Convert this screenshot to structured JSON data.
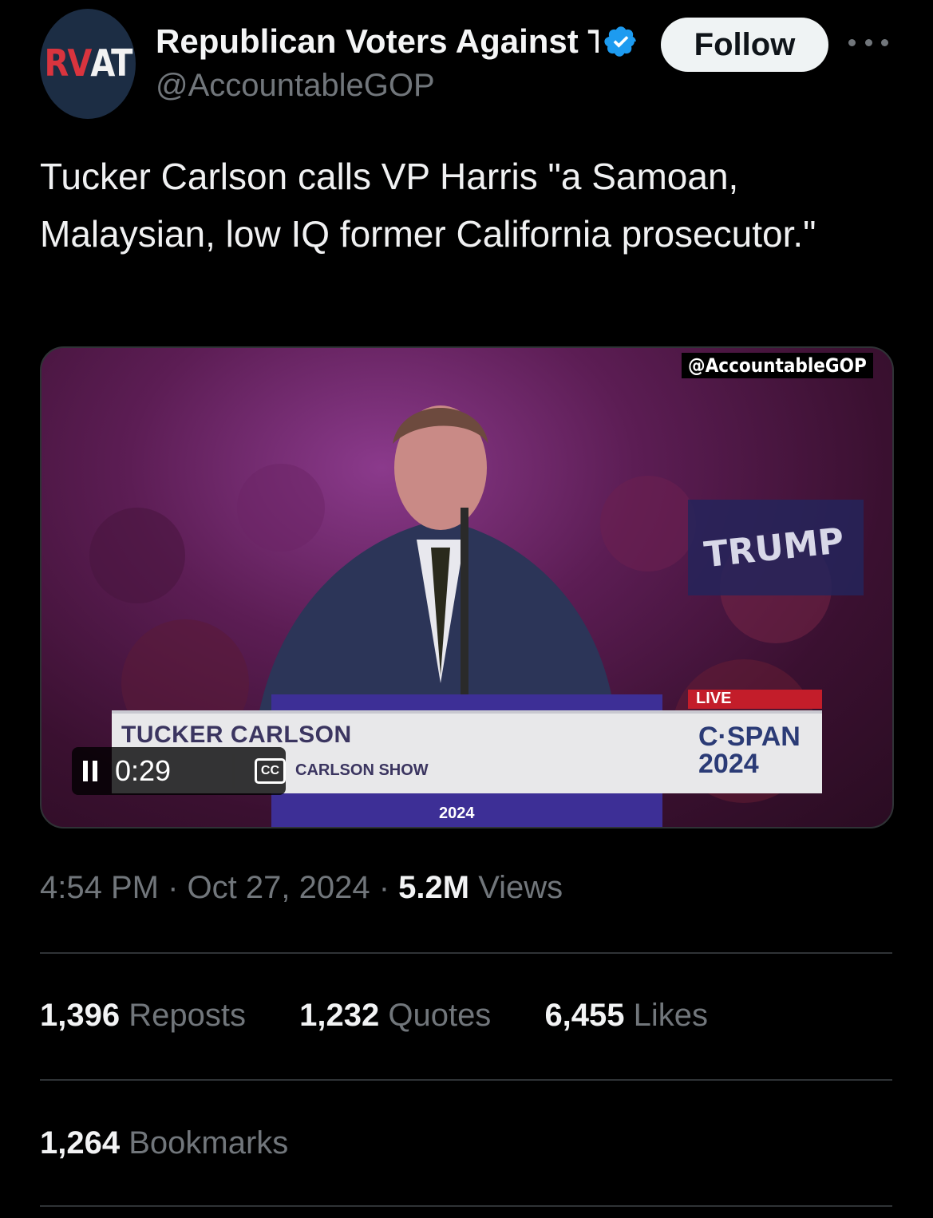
{
  "author": {
    "avatar_text_red": "RV",
    "avatar_text_white": "AT",
    "display_name": "Republican Voters Against Trump",
    "handle": "@AccountableGOP",
    "verified_icon": "verified-badge-icon"
  },
  "actions": {
    "follow_label": "Follow",
    "more_icon": "more-horizontal-icon"
  },
  "tweet": {
    "text": "Tucker Carlson calls VP Harris \"a Samoan, Malaysian, low IQ former California prosecutor.\""
  },
  "video": {
    "watermark": "@AccountableGOP",
    "lower_third_name": "TUCKER CARLSON",
    "lower_third_show": "CARLSON SHOW",
    "live_label": "LIVE",
    "network_line1": "C·SPAN",
    "network_line2": "2024",
    "podium_year": "2024",
    "time": "0:29",
    "cc_label": "CC",
    "pause_icon": "pause-icon"
  },
  "meta": {
    "time": "4:54 PM",
    "date": "Oct 27, 2024",
    "views_count": "5.2M",
    "views_label": "Views"
  },
  "stats": {
    "reposts_count": "1,396",
    "reposts_label": "Reposts",
    "quotes_count": "1,232",
    "quotes_label": "Quotes",
    "likes_count": "6,455",
    "likes_label": "Likes",
    "bookmarks_count": "1,264",
    "bookmarks_label": "Bookmarks"
  },
  "colors": {
    "background": "#000000",
    "verified_blue": "#1d9bf0",
    "muted_text": "#71767b",
    "follow_bg": "#eff3f4"
  }
}
